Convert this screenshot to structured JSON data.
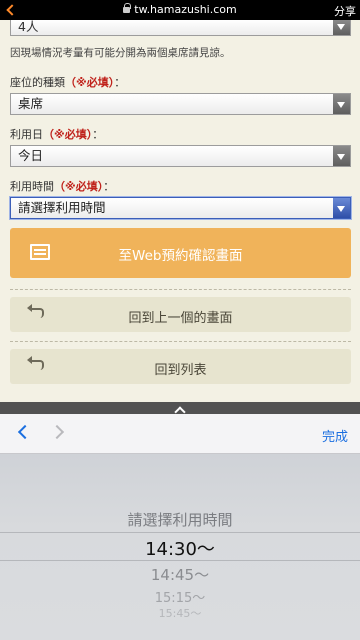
{
  "browser": {
    "url": "tw.hamazushi.com",
    "share_label": "分享"
  },
  "form": {
    "party_size_value": "4人",
    "seat_note": "因現場情況考量有可能分開為兩個桌席請見諒。",
    "seat_label": "座位的種類",
    "seat_required": "（※必填）",
    "seat_colon": "：",
    "seat_value": "桌席",
    "date_label": "利用日",
    "date_required": "（※必填）",
    "date_colon": "：",
    "date_value": "今日",
    "time_label": "利用時間",
    "time_required": "（※必填）",
    "time_colon": "：",
    "time_value": "請選擇利用時間"
  },
  "buttons": {
    "confirm_label": "至Web預約確認畫面",
    "back_label": "回到上一個的畫面",
    "list_label": "回到列表"
  },
  "keyboard_bar": {
    "done_label": "完成"
  },
  "picker": {
    "options": [
      "請選擇利用時間",
      "14:30～",
      "14:45～",
      "15:15～",
      "15:45～"
    ],
    "selected_index": 1
  },
  "colors": {
    "accent_orange": "#f0b35a",
    "required_red": "#c0221b",
    "ios_blue": "#1b6fe0",
    "page_bg": "#f3f1e4"
  }
}
